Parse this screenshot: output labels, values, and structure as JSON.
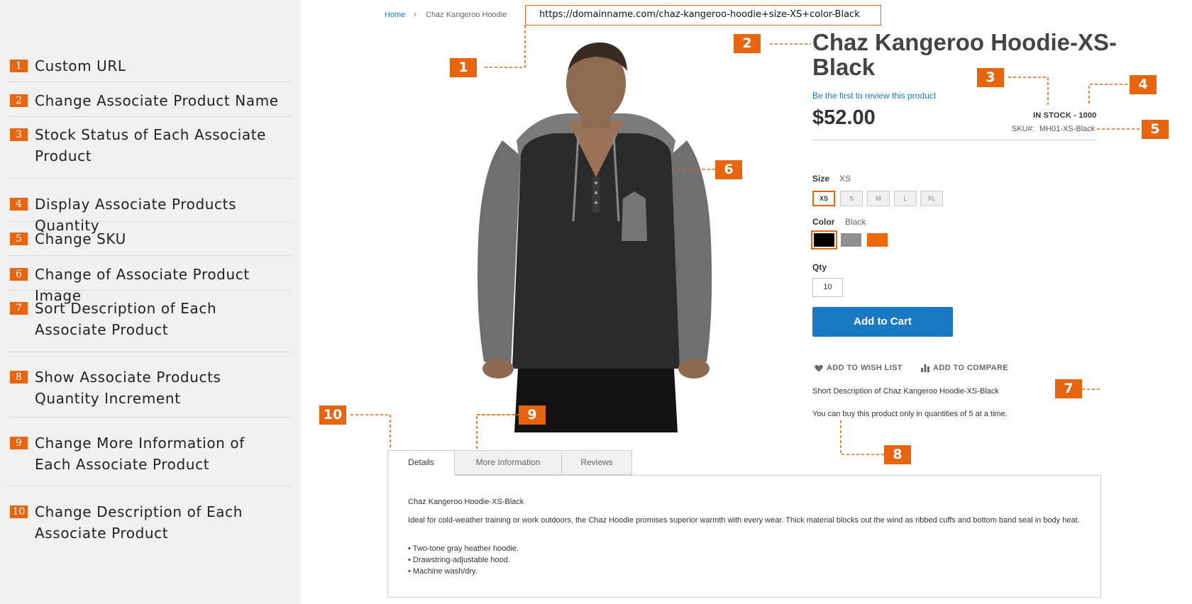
{
  "sidebar": {
    "features": [
      {
        "num": "1",
        "label": "Custom URL"
      },
      {
        "num": "2",
        "label": "Change Associate Product Name"
      },
      {
        "num": "3",
        "label": "Stock Status of Each Associate Product"
      },
      {
        "num": "4",
        "label": "Display Associate Products Quantity"
      },
      {
        "num": "5",
        "label": "Change SKU"
      },
      {
        "num": "6",
        "label": "Change of Associate Product Image"
      },
      {
        "num": "7",
        "label": "Sort Description of Each Associate Product"
      },
      {
        "num": "8",
        "label": "Show Associate Products Quantity Increment"
      },
      {
        "num": "9",
        "label": "Change More Information of Each Associate Product"
      },
      {
        "num": "10",
        "label": "Change Description of Each Associate Product"
      }
    ]
  },
  "breadcrumb": {
    "home": "Home",
    "separator": "›",
    "current": "Chaz Kangeroo Hoodie"
  },
  "url": "https://domainname.com/chaz-kangeroo-hoodie+size-XS+color-Black",
  "product": {
    "name": "Chaz Kangeroo Hoodie-XS-Black",
    "review_link": "Be the first to review this product",
    "price": "$52.00",
    "stock": "IN STOCK - 1000",
    "sku_label": "SKU#:",
    "sku": "MH01-XS-Black",
    "size_label": "Size",
    "size_value": "XS",
    "sizes": [
      "XS",
      "S",
      "M",
      "L",
      "XL"
    ],
    "color_label": "Color",
    "color_value": "Black",
    "colors": [
      "#000000",
      "#8f8f8f",
      "#eb6709"
    ],
    "qty_label": "Qty",
    "qty": "10",
    "add_to_cart": "Add to Cart",
    "wishlist": "ADD TO WISH LIST",
    "compare": "ADD TO COMPARE",
    "short_description": "Short Description of Chaz Kangeroo Hoodie-XS-Black",
    "qty_increment": "You can buy this product only in quantities of 5 at a time."
  },
  "tabs": {
    "items": [
      "Details",
      "More Information",
      "Reviews"
    ],
    "panel_title": "Chaz Kangeroo Hoodie-XS-Black",
    "panel_description": "Ideal for cold-weather training or work outdoors, the Chaz Hoodie promises superior warmth with every wear. Thick material blocks out the wind as ribbed cuffs and bottom band seal in body heat.",
    "panel_bullets": [
      "• Two-tone gray heather hoodie.",
      "• Drawstring-adjustable hood.",
      "• Machine wash/dry."
    ]
  },
  "callouts": [
    "1",
    "2",
    "3",
    "4",
    "5",
    "6",
    "7",
    "8",
    "9",
    "10"
  ],
  "colors": {
    "accent": "#e8650f",
    "link": "#1979c3",
    "button": "#1979c3",
    "sidebar_bg": "#f0f0f0"
  }
}
